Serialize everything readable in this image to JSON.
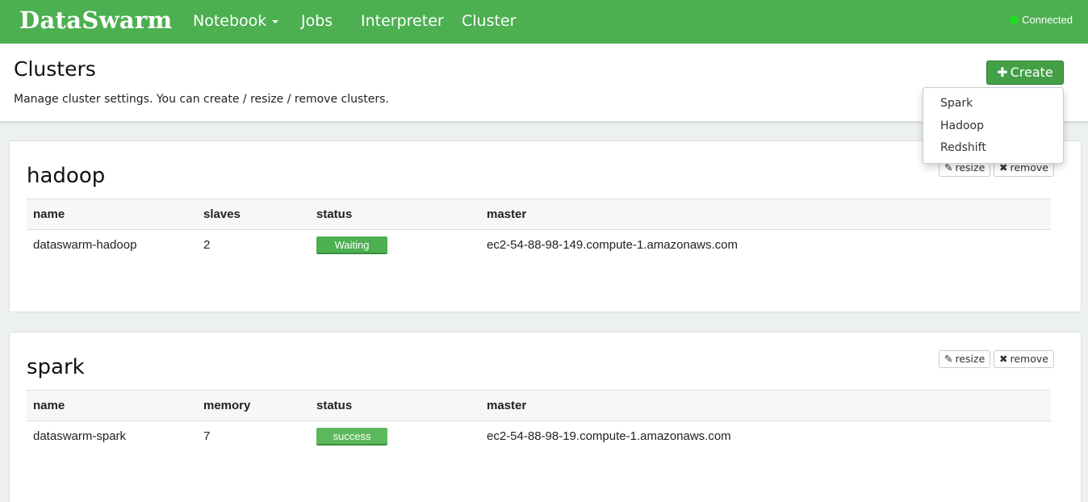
{
  "navbar": {
    "brand": "DataSwarm",
    "items": [
      {
        "label": "Notebook",
        "has_caret": true
      },
      {
        "label": "Jobs"
      },
      {
        "label": "Interpreter"
      },
      {
        "label": "Cluster"
      }
    ],
    "status": "Connected",
    "status_color": "#22dd22",
    "bar_color": "#4caf50"
  },
  "header": {
    "title": "Clusters",
    "description": "Manage cluster settings. You can create / resize / remove clusters.",
    "create_label": "Create",
    "create_icon": "plus-icon"
  },
  "create_menu": {
    "items": [
      "Spark",
      "Hadoop",
      "Redshift"
    ]
  },
  "clusters": [
    {
      "title": "hadoop",
      "resize_label": "resize",
      "remove_label": "remove",
      "columns": [
        "name",
        "slaves",
        "status",
        "master"
      ],
      "rows": [
        {
          "name": "dataswarm-hadoop",
          "count": "2",
          "status": "Waiting",
          "master": "ec2-54-88-98-149.compute-1.amazonaws.com"
        }
      ]
    },
    {
      "title": "spark",
      "resize_label": "resize",
      "remove_label": "remove",
      "columns": [
        "name",
        "memory",
        "status",
        "master"
      ],
      "rows": [
        {
          "name": "dataswarm-spark",
          "count": "7",
          "status": "success",
          "master": "ec2-54-88-98-19.compute-1.amazonaws.com"
        }
      ]
    }
  ]
}
